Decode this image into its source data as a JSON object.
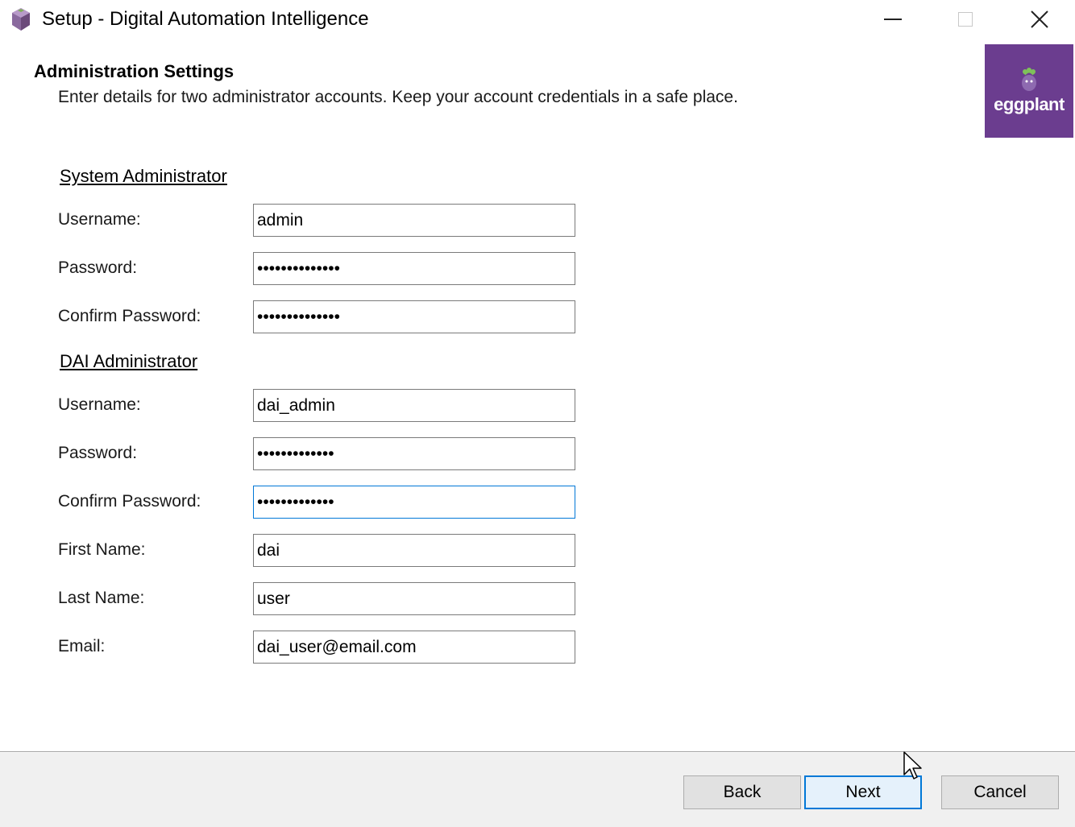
{
  "window": {
    "title": "Setup - Digital Automation Intelligence",
    "icon": "installer-box-icon"
  },
  "header": {
    "title": "Administration Settings",
    "description": "Enter details for two administrator accounts. Keep your account credentials in a safe place.",
    "logo_text": "eggplant",
    "logo_color": "#6b3d8f"
  },
  "system_admin": {
    "section_label": "System Administrator",
    "username_label": "Username:",
    "username_value": "admin",
    "password_label": "Password:",
    "password_value": "admin_password",
    "confirm_label": "Confirm Password:",
    "confirm_value": "admin_password"
  },
  "dai_admin": {
    "section_label": "DAI Administrator",
    "username_label": "Username:",
    "username_value": "dai_admin",
    "password_label": "Password:",
    "password_value": "dai_password1",
    "confirm_label": "Confirm Password:",
    "confirm_value": "dai_password1",
    "first_name_label": "First Name:",
    "first_name_value": "dai",
    "last_name_label": "Last Name:",
    "last_name_value": "user",
    "email_label": "Email:",
    "email_value": "dai_user@email.com"
  },
  "buttons": {
    "back": "Back",
    "next": "Next",
    "cancel": "Cancel"
  },
  "colors": {
    "focus": "#0078d7",
    "footer_bg": "#f0f0f0"
  }
}
